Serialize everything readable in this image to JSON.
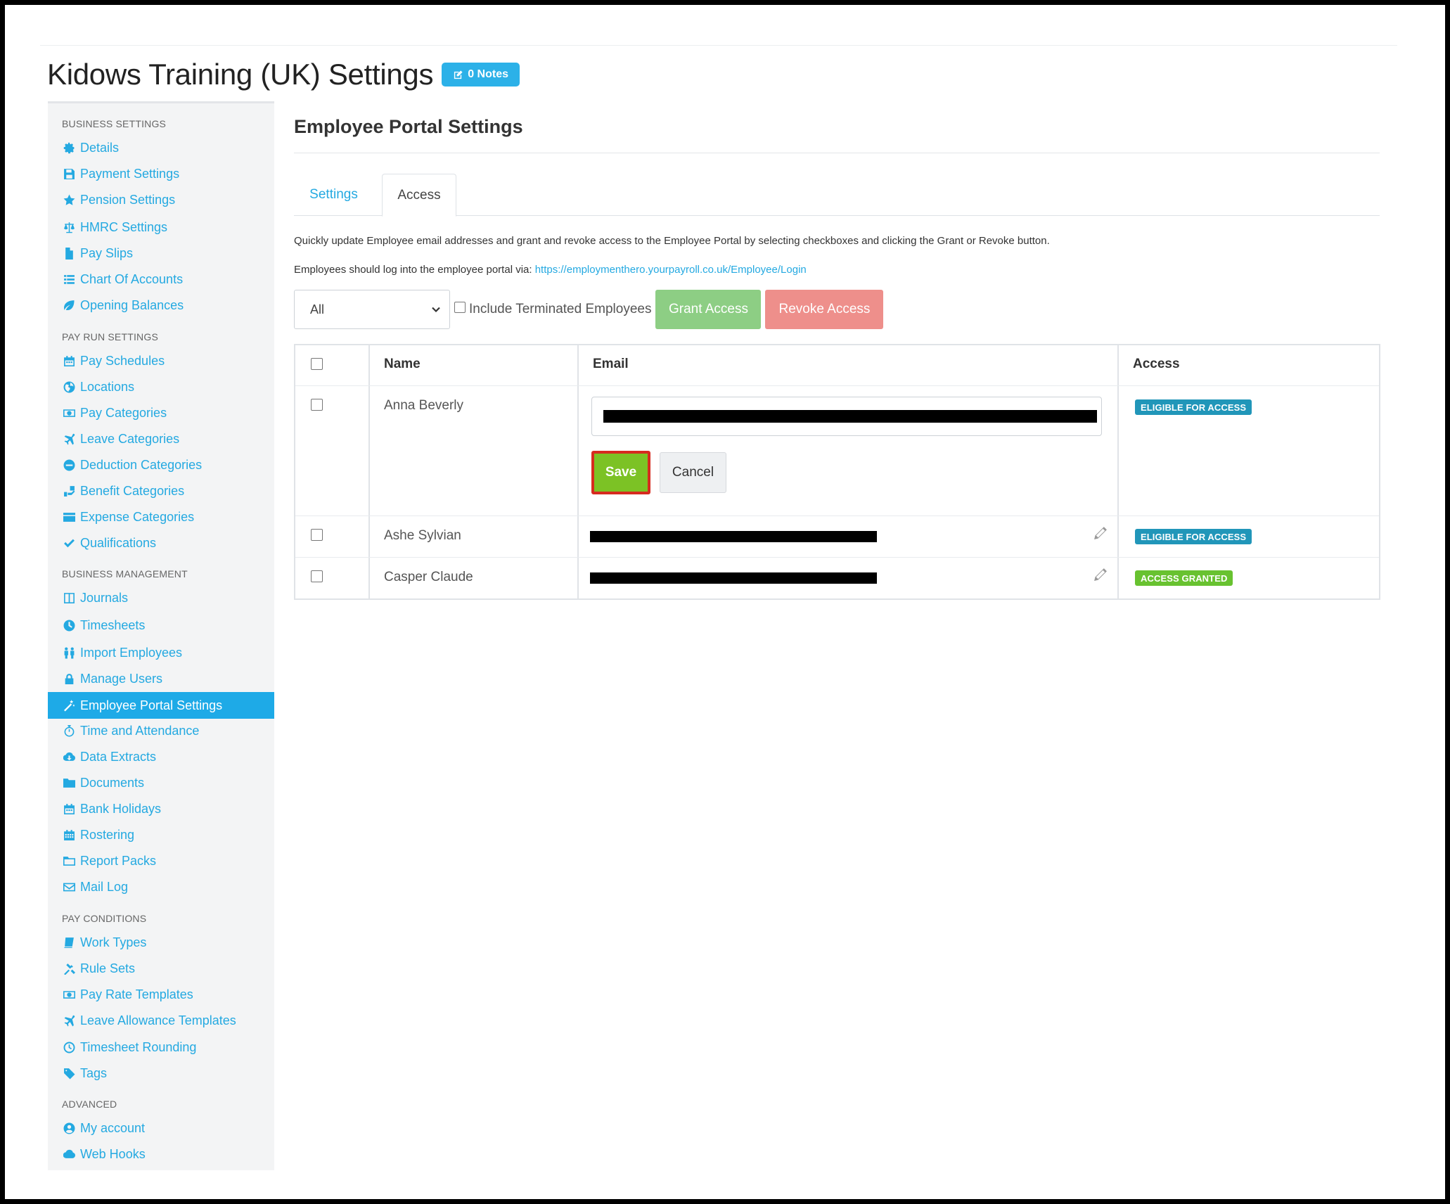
{
  "header": {
    "title": "Kidows Training (UK) Settings",
    "notes_label": "0 Notes"
  },
  "sidebar": {
    "sections": [
      {
        "title": "BUSINESS SETTINGS",
        "items": [
          {
            "label": "Details",
            "icon": "gear-icon"
          },
          {
            "label": "Payment Settings",
            "icon": "floppy-icon"
          },
          {
            "label": "Pension Settings",
            "icon": "star-icon"
          },
          {
            "label": "HMRC Settings",
            "icon": "scales-icon"
          },
          {
            "label": "Pay Slips",
            "icon": "file-icon"
          },
          {
            "label": "Chart Of Accounts",
            "icon": "list-icon"
          },
          {
            "label": "Opening Balances",
            "icon": "leaf-icon"
          }
        ]
      },
      {
        "title": "PAY RUN SETTINGS",
        "items": [
          {
            "label": "Pay Schedules",
            "icon": "calendar-icon"
          },
          {
            "label": "Locations",
            "icon": "globe-icon"
          },
          {
            "label": "Pay Categories",
            "icon": "money-icon"
          },
          {
            "label": "Leave Categories",
            "icon": "plane-icon"
          },
          {
            "label": "Deduction Categories",
            "icon": "minus-circle-icon"
          },
          {
            "label": "Benefit Categories",
            "icon": "gift-icon"
          },
          {
            "label": "Expense Categories",
            "icon": "card-icon"
          },
          {
            "label": "Qualifications",
            "icon": "check-icon"
          }
        ]
      },
      {
        "title": "BUSINESS MANAGEMENT",
        "items": [
          {
            "label": "Journals",
            "icon": "columns-icon"
          },
          {
            "label": "Timesheets",
            "icon": "clock-icon"
          },
          {
            "label": "Import Employees",
            "icon": "people-icon"
          },
          {
            "label": "Manage Users",
            "icon": "lock-icon"
          },
          {
            "label": "Employee Portal Settings",
            "icon": "magic-wand-icon"
          },
          {
            "label": "Time and Attendance",
            "icon": "timer-icon"
          },
          {
            "label": "Data Extracts",
            "icon": "cloud-download-icon"
          },
          {
            "label": "Documents",
            "icon": "folder-icon"
          },
          {
            "label": "Bank Holidays",
            "icon": "calendar-icon"
          },
          {
            "label": "Rostering",
            "icon": "calendar-grid-icon"
          },
          {
            "label": "Report Packs",
            "icon": "folder-open-icon"
          },
          {
            "label": "Mail Log",
            "icon": "envelope-icon"
          }
        ]
      },
      {
        "title": "PAY CONDITIONS",
        "items": [
          {
            "label": "Work Types",
            "icon": "book-icon"
          },
          {
            "label": "Rule Sets",
            "icon": "gavel-icon"
          },
          {
            "label": "Pay Rate Templates",
            "icon": "money-icon"
          },
          {
            "label": "Leave Allowance Templates",
            "icon": "plane-icon"
          },
          {
            "label": "Timesheet Rounding",
            "icon": "clock-outline-icon"
          },
          {
            "label": "Tags",
            "icon": "tag-icon"
          }
        ]
      },
      {
        "title": "ADVANCED",
        "items": [
          {
            "label": "My account",
            "icon": "user-circle-icon"
          },
          {
            "label": "Web Hooks",
            "icon": "cloud-icon"
          }
        ]
      }
    ],
    "active": "Employee Portal Settings"
  },
  "main": {
    "title": "Employee Portal Settings",
    "tabs": [
      {
        "label": "Settings"
      },
      {
        "label": "Access"
      }
    ],
    "active_tab": "Access",
    "description": "Quickly update Employee email addresses and grant and revoke access to the Employee Portal by selecting checkboxes and clicking the Grant or Revoke button.",
    "login_prefix": "Employees should log into the employee portal via: ",
    "login_url": "https://employmenthero.yourpayroll.co.uk/Employee/Login",
    "filter": {
      "selected": "All"
    },
    "include_terminated_label": "Include Terminated Employees",
    "grant_label": "Grant Access",
    "revoke_label": "Revoke Access",
    "table": {
      "headers": {
        "name": "Name",
        "email": "Email",
        "access": "Access"
      },
      "rows": [
        {
          "name": "Anna Beverly",
          "access": "ELIGIBLE FOR ACCESS"
        },
        {
          "name": "Ashe Sylvian",
          "access": "ELIGIBLE FOR ACCESS"
        },
        {
          "name": "Casper Claude",
          "access": "ACCESS GRANTED"
        }
      ],
      "save_label": "Save",
      "cancel_label": "Cancel"
    }
  },
  "colors": {
    "accent": "#24a9e1",
    "grant": "#8dce84",
    "revoke": "#ee8f8b",
    "eligible": "#2196b9",
    "granted": "#68c230"
  }
}
